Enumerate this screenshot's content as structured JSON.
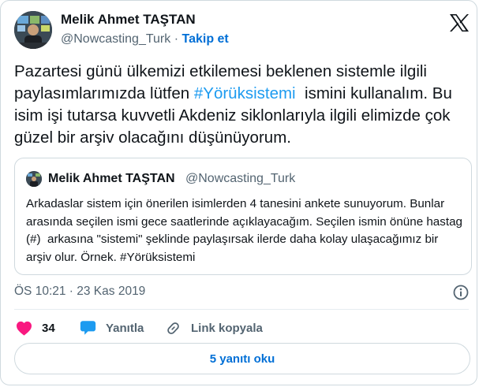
{
  "author": {
    "name": "Melik Ahmet TAŞTAN",
    "handle": "@Nowcasting_Turk",
    "separator": "·",
    "follow_label": "Takip et"
  },
  "tweet": {
    "text_before": "Pazartesi günü ülkemizi etkilemesi beklenen sistemle ilgili paylasımlarımızda lütfen ",
    "hashtag": "#Yörüksistemi",
    "text_after": "  ismini kullanalım. Bu isim işi tutarsa kuvvetli Akdeniz siklonlarıyla ilgili elimizde çok güzel bir arşiv olacağını düşünüyorum."
  },
  "quote": {
    "name": "Melik Ahmet TAŞTAN",
    "handle": "@Nowcasting_Turk",
    "text": "Arkadaslar sistem için önerilen isimlerden 4 tanesini ankete sunuyorum. Bunlar arasında seçilen ismi gece saatlerinde açıklayacağım. Seçilen ismin önüne hastag  (#)  arkasına \"sistemi\" şeklinde paylaşırsak ilerde daha kolay ulaşacağımız bir arşiv olur. Örnek. #Yörüksistemi"
  },
  "timestamp": "ÖS 10:21 · 23 Kas 2019",
  "actions": {
    "like_count": "34",
    "reply_label": "Yanıtla",
    "copy_link_label": "Link kopyala"
  },
  "read_replies_label": "5 yanıtı oku",
  "icons": {
    "logo": "x-logo-icon",
    "like": "heart-icon",
    "reply": "speech-bubble-icon",
    "link": "link-icon",
    "info": "info-icon"
  },
  "colors": {
    "link_blue": "#006fd6",
    "hashtag_blue": "#1d9bf0",
    "like_pink": "#f91880",
    "reply_blue": "#1d9bf0",
    "text_primary": "#0f1419",
    "text_secondary": "#536471",
    "border": "#cfd9de"
  }
}
